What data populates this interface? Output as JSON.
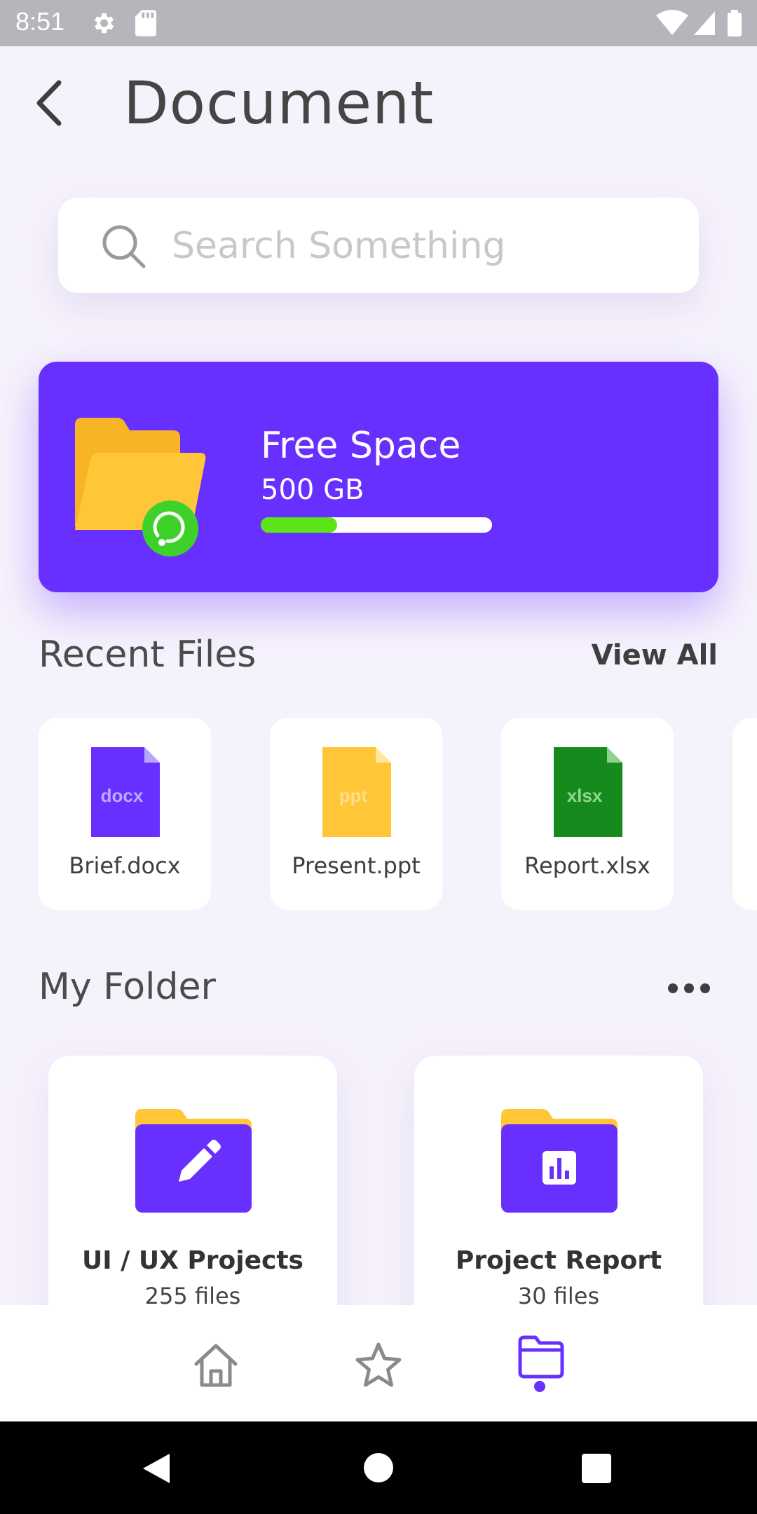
{
  "status_bar": {
    "time": "8:51",
    "icons": [
      "settings-gear-icon",
      "sd-card-icon",
      "wifi-icon",
      "signal-icon",
      "battery-icon"
    ]
  },
  "header": {
    "title": "Document",
    "back_icon": "back-arrow-icon"
  },
  "search": {
    "placeholder": "Search Something",
    "icon": "search-icon"
  },
  "storage": {
    "label": "Free Space",
    "size": "500 GB",
    "progress_fraction": 0.33,
    "colors": {
      "card": "#6830FF",
      "bar_fill": "#5CE419",
      "folder": "#FFC637",
      "badge": "#3ED12A"
    }
  },
  "recent_files": {
    "title": "Recent Files",
    "view_all": "View All",
    "items": [
      {
        "name": "Brief.docx",
        "type_label": "docx",
        "color": "#6830FF"
      },
      {
        "name": "Present.ppt",
        "type_label": "ppt",
        "color": "#FFC637"
      },
      {
        "name": "Report.xlsx",
        "type_label": "xlsx",
        "color": "#178A1E"
      }
    ]
  },
  "my_folder": {
    "title": "My Folder",
    "more_icon": "more-horizontal-icon",
    "items": [
      {
        "name": "UI / UX Projects",
        "count": "255 files",
        "icon": "pencil-icon"
      },
      {
        "name": "Project Report",
        "count": "30 files",
        "icon": "bar-chart-icon"
      }
    ]
  },
  "bottom_nav": {
    "items": [
      "home-icon",
      "star-icon",
      "folder-icon"
    ],
    "active": "folder-icon"
  }
}
